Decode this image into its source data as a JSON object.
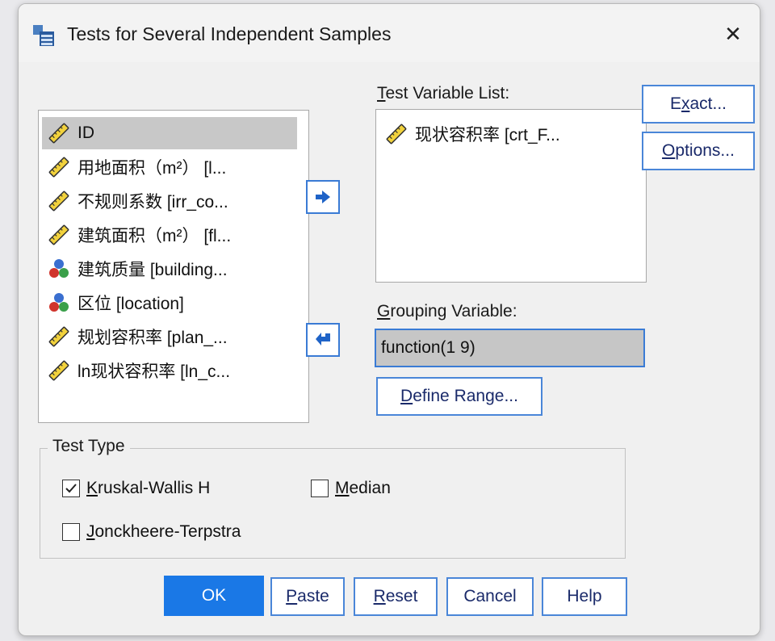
{
  "window": {
    "title": "Tests for Several Independent Samples",
    "close_glyph": "✕"
  },
  "variables": [
    {
      "label": "ID",
      "icon": "scale-ruler-icon",
      "selected": true
    },
    {
      "label": "用地面积（m²） [l...",
      "icon": "scale-ruler-icon"
    },
    {
      "label": "不规则系数 [irr_co...",
      "icon": "scale-ruler-icon"
    },
    {
      "label": "建筑面积（m²） [fl...",
      "icon": "scale-ruler-icon"
    },
    {
      "label": "建筑质量 [building...",
      "icon": "nominal-balls-icon"
    },
    {
      "label": "区位 [location]",
      "icon": "nominal-balls-icon"
    },
    {
      "label": "规划容积率 [plan_...",
      "icon": "scale-ruler-icon"
    },
    {
      "label": "ln现状容积率 [ln_c...",
      "icon": "scale-ruler-icon"
    }
  ],
  "test_variable_list": {
    "label_prefix": "T",
    "label_rest": "est Variable List:",
    "items": [
      {
        "label": "现状容积率 [crt_F...",
        "icon": "scale-ruler-icon"
      }
    ]
  },
  "grouping": {
    "label_prefix": "G",
    "label_rest": "rouping Variable:",
    "value": "function(1 9)",
    "define_range_prefix": "D",
    "define_range_rest": "efine Range..."
  },
  "side_buttons": {
    "exact_a": "E",
    "exact_u": "x",
    "exact_b": "act...",
    "options_u": "O",
    "options_b": "ptions..."
  },
  "test_type": {
    "legend": "Test Type",
    "kruskal_u": "K",
    "kruskal_b": "ruskal-Wallis H",
    "kruskal_checked": true,
    "median_u": "M",
    "median_b": "edian",
    "median_checked": false,
    "jonck_u": "J",
    "jonck_b": "onckheere-Terpstra",
    "jonck_checked": false
  },
  "footer": {
    "ok": "OK",
    "paste_u": "P",
    "paste_b": "aste",
    "reset_u": "R",
    "reset_b": "eset",
    "cancel": "Cancel",
    "help": "Help"
  },
  "colors": {
    "accent": "#1a78e6",
    "border_blue": "#3a7bd5"
  }
}
